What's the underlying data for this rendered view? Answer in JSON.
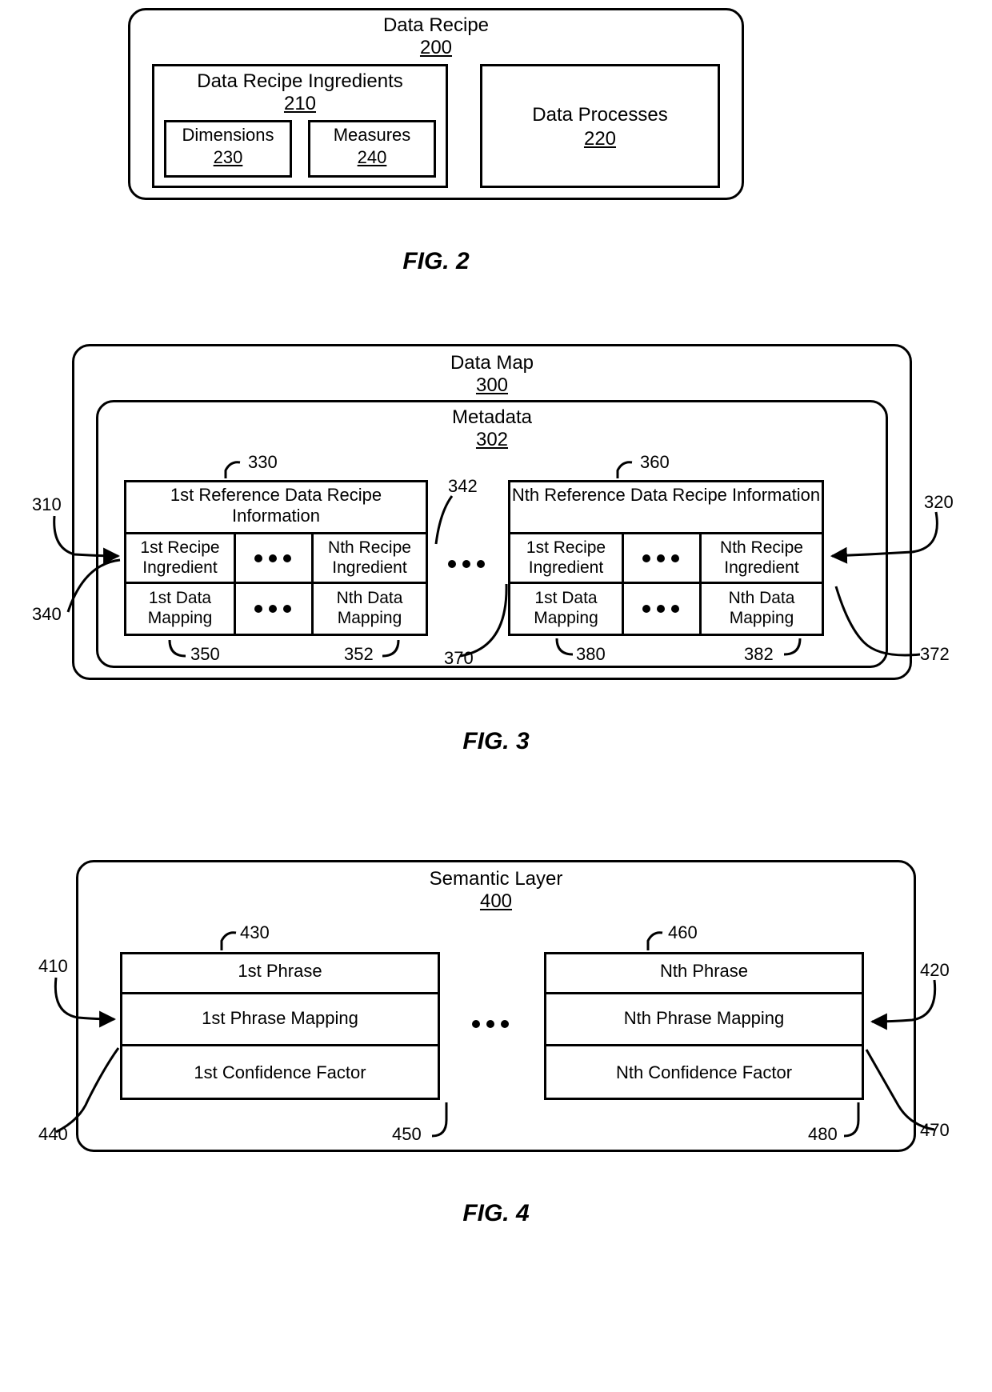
{
  "fig2": {
    "caption": "FIG. 2",
    "outer": {
      "title": "Data Recipe",
      "ref": "200"
    },
    "ingredients": {
      "title": "Data Recipe Ingredients",
      "ref": "210"
    },
    "dimensions": {
      "title": "Dimensions",
      "ref": "230"
    },
    "measures": {
      "title": "Measures",
      "ref": "240"
    },
    "processes": {
      "title": "Data Processes",
      "ref": "220"
    }
  },
  "fig3": {
    "caption": "FIG. 3",
    "outer": {
      "title": "Data Map",
      "ref": "300"
    },
    "meta": {
      "title": "Metadata",
      "ref": "302"
    },
    "leftBlock": {
      "header": "1st Reference Data Recipe Information",
      "r1c1": "1st Recipe Ingredient",
      "r1c3": "Nth Recipe Ingredient",
      "r2c1": "1st Data Mapping",
      "r2c3": "Nth Data Mapping"
    },
    "rightBlock": {
      "header": "Nth Reference Data Recipe Information",
      "r1c1": "1st Recipe Ingredient",
      "r1c3": "Nth Recipe Ingredient",
      "r2c1": "1st Data Mapping",
      "r2c3": "Nth Data Mapping"
    },
    "refs": {
      "r310": "310",
      "r320": "320",
      "r330": "330",
      "r340": "340",
      "r342": "342",
      "r350": "350",
      "r352": "352",
      "r360": "360",
      "r370": "370",
      "r372": "372",
      "r380": "380",
      "r382": "382"
    }
  },
  "fig4": {
    "caption": "FIG. 4",
    "outer": {
      "title": "Semantic Layer",
      "ref": "400"
    },
    "left": {
      "row1": "1st Phrase",
      "row2": "1st Phrase Mapping",
      "row3": "1st Confidence Factor"
    },
    "right": {
      "row1": "Nth Phrase",
      "row2": "Nth Phrase Mapping",
      "row3": "Nth Confidence Factor"
    },
    "refs": {
      "r410": "410",
      "r420": "420",
      "r430": "430",
      "r440": "440",
      "r450": "450",
      "r460": "460",
      "r470": "470",
      "r480": "480"
    }
  }
}
